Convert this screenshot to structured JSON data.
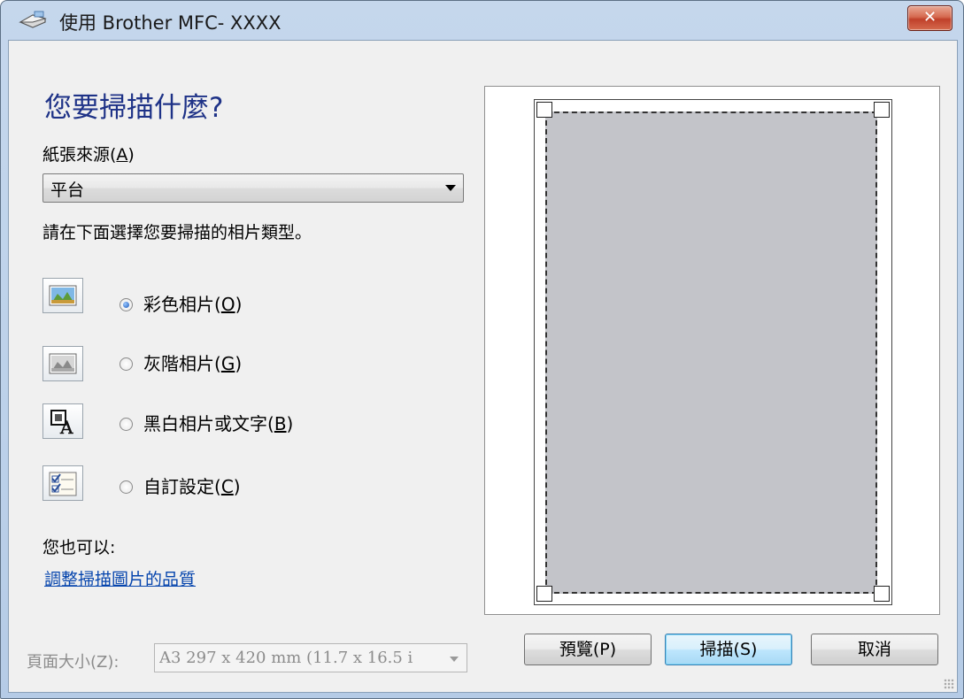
{
  "window": {
    "title": "使用 Brother MFC- XXXX",
    "close_label": "✕"
  },
  "main": {
    "heading": "您要掃描什麼?",
    "paper_source_label_pre": "紙張來源(",
    "paper_source_label_key": "A",
    "paper_source_label_post": ")",
    "paper_source_value": "平台",
    "instruction": "請在下面選擇您要掃描的相片類型。",
    "options": [
      {
        "label": "彩色相片(",
        "key": "O",
        "post": ")",
        "selected": true,
        "icon": "color-picture-icon"
      },
      {
        "label": "灰階相片(",
        "key": "G",
        "post": ")",
        "selected": false,
        "icon": "grayscale-picture-icon"
      },
      {
        "label": "黑白相片或文字(",
        "key": "B",
        "post": ")",
        "selected": false,
        "icon": "black-white-text-icon"
      },
      {
        "label": "自訂設定(",
        "key": "C",
        "post": ")",
        "selected": false,
        "icon": "custom-settings-icon"
      }
    ],
    "also_label": "您也可以:",
    "quality_link": "調整掃描圖片的品質",
    "page_size_label": "頁面大小(Z):",
    "page_size_value": "A3 297 x 420 mm (11.7 x 16.5 i"
  },
  "buttons": {
    "preview": "預覽(P)",
    "scan": "掃描(S)",
    "cancel": "取消"
  },
  "colors": {
    "heading": "#1e3287",
    "link": "#0645ad",
    "preview_area": "#c3c4c9"
  }
}
